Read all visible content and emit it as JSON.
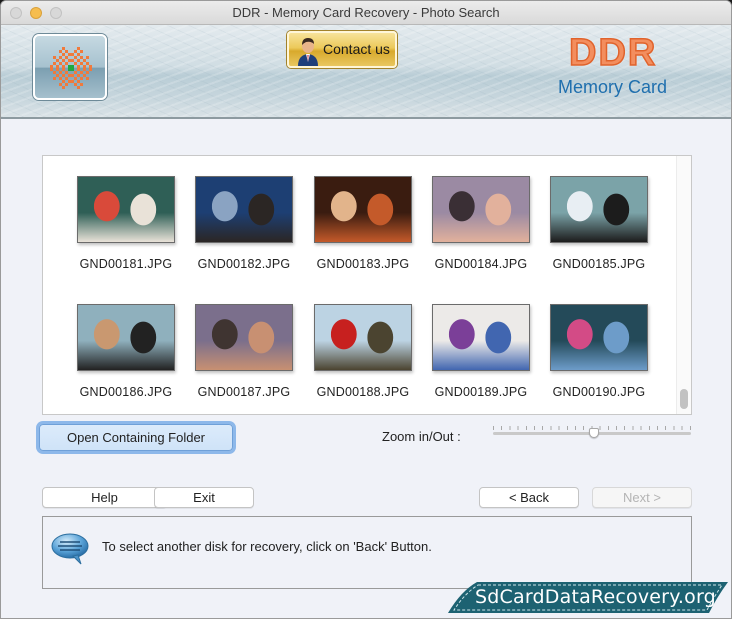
{
  "window": {
    "title": "DDR - Memory Card Recovery - Photo Search"
  },
  "banner": {
    "contact_label": "Contact us",
    "brand_title": "DDR",
    "brand_subtitle": "Memory Card"
  },
  "gallery": {
    "items": [
      {
        "filename": "GND00181.JPG",
        "colors": [
          "#2f5f56",
          "#e9e2d8",
          "#d94a3a"
        ]
      },
      {
        "filename": "GND00182.JPG",
        "colors": [
          "#1d3f73",
          "#2b2624",
          "#8aa3c2"
        ]
      },
      {
        "filename": "GND00183.JPG",
        "colors": [
          "#3a1c10",
          "#c45a2a",
          "#e2b48b"
        ]
      },
      {
        "filename": "GND00184.JPG",
        "colors": [
          "#9b8aa3",
          "#e2b19c",
          "#3a2f35"
        ]
      },
      {
        "filename": "GND00185.JPG",
        "colors": [
          "#7ba3a8",
          "#1c1c1c",
          "#e8eef3"
        ]
      },
      {
        "filename": "GND00186.JPG",
        "colors": [
          "#8fb0bd",
          "#222222",
          "#c99870"
        ]
      },
      {
        "filename": "GND00187.JPG",
        "colors": [
          "#7b6f8c",
          "#c89072",
          "#3f3431"
        ]
      },
      {
        "filename": "GND00188.JPG",
        "colors": [
          "#bcd3e3",
          "#4b4430",
          "#c7201f"
        ]
      },
      {
        "filename": "GND00189.JPG",
        "colors": [
          "#eceae8",
          "#4166b0",
          "#7b3f98"
        ]
      },
      {
        "filename": "GND00190.JPG",
        "colors": [
          "#244a59",
          "#6d9cc9",
          "#d34b86"
        ]
      }
    ],
    "scroll_position": 0.95
  },
  "controls": {
    "open_folder_label": "Open Containing Folder",
    "zoom_label": "Zoom in/Out :",
    "zoom_value": 0.51
  },
  "buttons": {
    "help": "Help",
    "exit": "Exit",
    "back": "< Back",
    "next": "Next >"
  },
  "status": {
    "message": "To select another disk for recovery, click on 'Back' Button."
  },
  "watermark": {
    "text": "SdCardDataRecovery.org"
  }
}
